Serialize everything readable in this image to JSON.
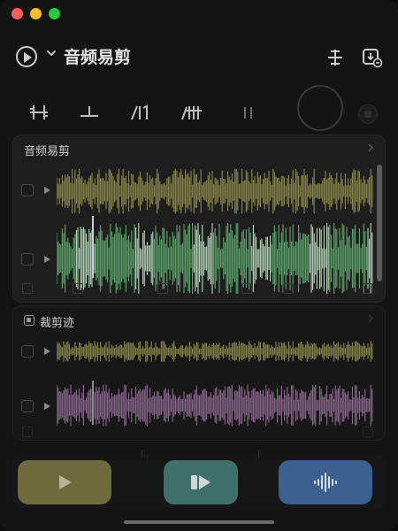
{
  "header": {
    "app_title": "音频易剪"
  },
  "track_group_1": {
    "title": "音频易剪"
  },
  "track_group_2": {
    "title": "裁剪迹"
  },
  "colors": {
    "yellow_wave": "#8c8a4c",
    "green_wave": "#5da86d",
    "green_wave_light": "#b8d8bd",
    "purple_wave": "#8f6a92",
    "btn_play": "#6f6a3c",
    "btn_audio": "#3e6f6a",
    "btn_wave": "#3b5f8e"
  },
  "icons": {
    "header_left": "play-circle-icon",
    "header_chevron": "chevron-down-icon",
    "header_right_1": "split-icon",
    "header_right_2": "export-icon",
    "toolbar": [
      "trim-icon",
      "split-line-icon",
      "fade-in-icon",
      "fade-out-icon",
      "pause-icon"
    ],
    "bottom": [
      "play-icon",
      "audio-play-icon",
      "waveform-icon"
    ]
  }
}
